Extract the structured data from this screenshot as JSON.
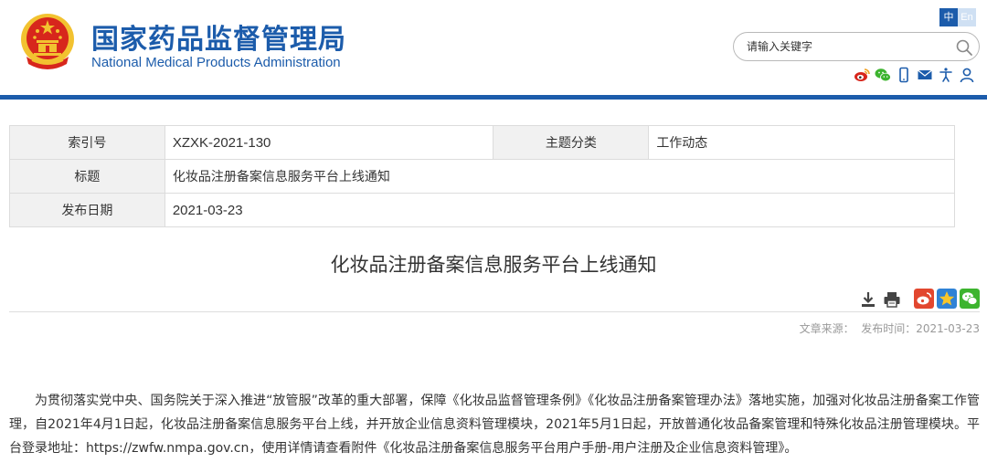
{
  "header": {
    "title_cn": "国家药品监督管理局",
    "title_en": "National Medical Products Administration",
    "lang_cn": "中",
    "lang_en": "En",
    "search_placeholder": "请输入关键字",
    "social_icons": [
      "weibo-icon",
      "wechat-icon",
      "mobile-icon",
      "mail-icon",
      "accessibility-icon",
      "user-icon"
    ]
  },
  "info": {
    "index_label": "索引号",
    "index_value": "XZXK-2021-130",
    "category_label": "主题分类",
    "category_value": "工作动态",
    "title_label": "标题",
    "title_value": "化妆品注册备案信息服务平台上线通知",
    "date_label": "发布日期",
    "date_value": "2021-03-23"
  },
  "article": {
    "title": "化妆品注册备案信息服务平台上线通知",
    "source_label": "文章来源：",
    "publish_label": "发布时间：2021-03-23",
    "paragraph": "为贯彻落实党中央、国务院关于深入推进“放管服”改革的重大部署，保障《化妆品监督管理条例》《化妆品注册备案管理办法》落地实施，加强对化妆品注册备案工作管理，自2021年4月1日起，化妆品注册备案信息服务平台上线，并开放企业信息资料管理模块，2021年5月1日起，开放普通化妆品备案管理和特殊化妆品注册管理模块。平台登录地址：https://zwfw.nmpa.gov.cn，使用详情请查看附件《化妆品注册备案信息服务平台用户手册-用户注册及企业信息资料管理》。",
    "tool_icons": [
      "download-icon",
      "print-icon"
    ],
    "share_icons": [
      "weibo-share-icon",
      "favorite-icon",
      "wechat-share-icon"
    ]
  },
  "colors": {
    "brand_blue": "#1c5cab",
    "emblem_red": "#d7261c",
    "emblem_gold": "#f2c230",
    "wechat_green": "#3db42f"
  }
}
